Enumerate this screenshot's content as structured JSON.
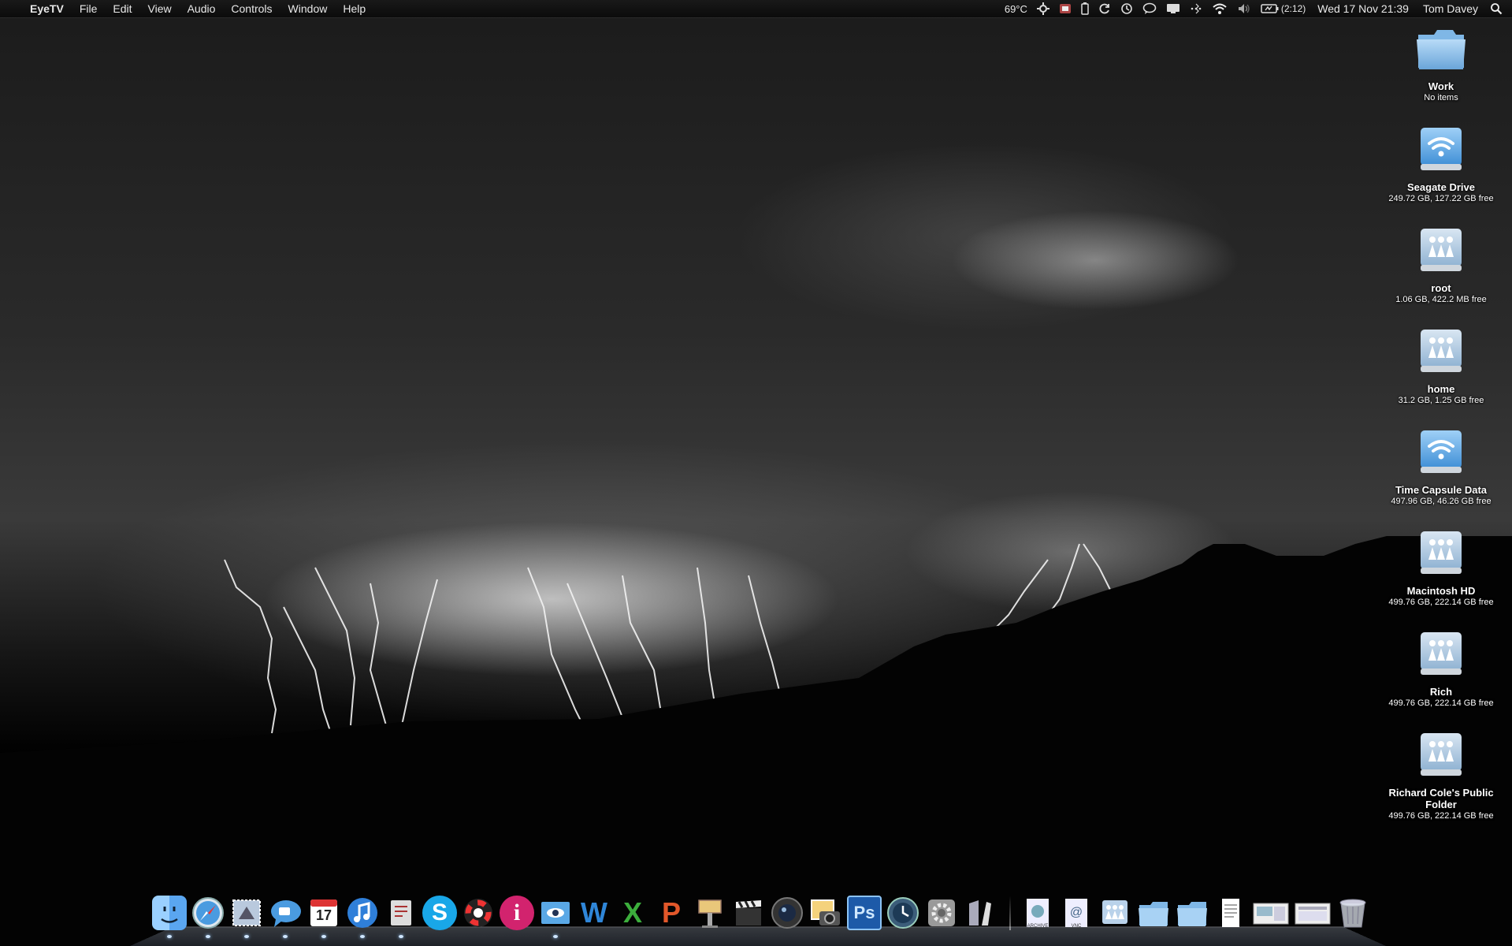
{
  "menubar": {
    "apple_glyph": "",
    "app_name": "EyeTV",
    "menus": [
      "File",
      "Edit",
      "View",
      "Audio",
      "Controls",
      "Window",
      "Help"
    ],
    "status": {
      "temperature": "69°C",
      "battery_time": "(2:12)",
      "clock": "Wed 17 Nov  21:39",
      "user": "Tom Davey"
    }
  },
  "desktop": {
    "items": [
      {
        "title": "Work",
        "sub": "No items",
        "icon": "folder-icon"
      },
      {
        "title": "Seagate Drive",
        "sub": "249.72 GB, 127.22 GB free",
        "icon": "wifi-drive-icon"
      },
      {
        "title": "root",
        "sub": "1.06 GB, 422.2 MB free",
        "icon": "network-share-icon"
      },
      {
        "title": "home",
        "sub": "31.2 GB, 1.25 GB free",
        "icon": "network-share-icon"
      },
      {
        "title": "Time Capsule Data",
        "sub": "497.96 GB, 46.26 GB free",
        "icon": "wifi-drive-icon"
      },
      {
        "title": "Macintosh HD",
        "sub": "499.76 GB, 222.14 GB free",
        "icon": "network-share-icon"
      },
      {
        "title": "Rich",
        "sub": "499.76 GB, 222.14 GB free",
        "icon": "network-share-icon"
      },
      {
        "title": "Richard Cole's Public Folder",
        "sub": "499.76 GB, 222.14 GB free",
        "icon": "network-share-icon"
      }
    ]
  },
  "dock": {
    "apps": [
      {
        "name": "finder",
        "running": true
      },
      {
        "name": "safari",
        "running": true
      },
      {
        "name": "mail",
        "running": true
      },
      {
        "name": "ichat",
        "running": true
      },
      {
        "name": "ical",
        "running": true,
        "date": "17"
      },
      {
        "name": "itunes",
        "running": true
      },
      {
        "name": "script-editor",
        "running": true
      },
      {
        "name": "skype",
        "running": false,
        "glyph": "S"
      },
      {
        "name": "lifesaver",
        "running": false
      },
      {
        "name": "pink-app",
        "running": false,
        "glyph": "i"
      },
      {
        "name": "preview",
        "running": true
      },
      {
        "name": "word",
        "running": false,
        "glyph": "W"
      },
      {
        "name": "excel",
        "running": false,
        "glyph": "X"
      },
      {
        "name": "powerpoint",
        "running": false,
        "glyph": "P"
      },
      {
        "name": "keynote",
        "running": false
      },
      {
        "name": "final-cut",
        "running": false
      },
      {
        "name": "aperture",
        "running": false
      },
      {
        "name": "iphoto",
        "running": false
      },
      {
        "name": "photoshop",
        "running": false,
        "glyph": "Ps"
      },
      {
        "name": "time-machine",
        "running": false
      },
      {
        "name": "system-preferences",
        "running": false
      },
      {
        "name": "utilities",
        "running": false
      }
    ],
    "stacks": [
      {
        "name": "archive",
        "label": "ARCHIVE"
      },
      {
        "name": "vnc",
        "label": "VNC"
      },
      {
        "name": "network-share"
      },
      {
        "name": "folder-1"
      },
      {
        "name": "folder-2"
      },
      {
        "name": "document"
      },
      {
        "name": "screenshot-1"
      },
      {
        "name": "screenshot-2"
      },
      {
        "name": "trash"
      }
    ]
  }
}
